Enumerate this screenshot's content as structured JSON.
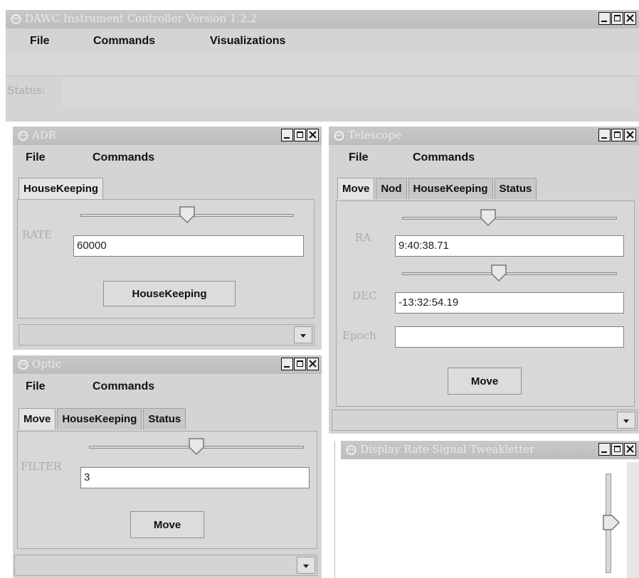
{
  "main": {
    "title": "DAWC Instrument Controller Version 1.2.2",
    "menus": [
      "File",
      "Commands",
      "Visualizations"
    ],
    "status_label": "Status:"
  },
  "adr": {
    "title": "ADR",
    "menus": [
      "File",
      "Commands"
    ],
    "tabs": [
      "HouseKeeping"
    ],
    "rate_label": "RATE",
    "rate_value": "60000",
    "button": "HouseKeeping",
    "slider_level": 0.5
  },
  "optic": {
    "title": "Optic",
    "menus": [
      "File",
      "Commands"
    ],
    "tabs": [
      "Move",
      "HouseKeeping",
      "Status"
    ],
    "filter_label": "FILTER",
    "filter_value": "3",
    "button": "Move",
    "slider_level": 0.5
  },
  "telescope": {
    "title": "Telescope",
    "menus": [
      "File",
      "Commands"
    ],
    "tabs": [
      "Move",
      "Nod",
      "HouseKeeping",
      "Status"
    ],
    "ra_label": "RA",
    "ra_value": "9:40:38.71",
    "dec_label": "DEC",
    "dec_value": "-13:32:54.19",
    "epoch_label": "Epoch",
    "epoch_value": "",
    "button": "Move",
    "ra_slider_level": 0.4,
    "dec_slider_level": 0.45
  },
  "display": {
    "title": "Display Rate Signal Tweakletter",
    "slider_level": 0.5
  },
  "icons": {
    "window": "app-window-icon",
    "minimize": "minimize-icon",
    "maximize": "maximize-icon",
    "close": "close-icon",
    "dropdown": "chevron-down-icon"
  }
}
